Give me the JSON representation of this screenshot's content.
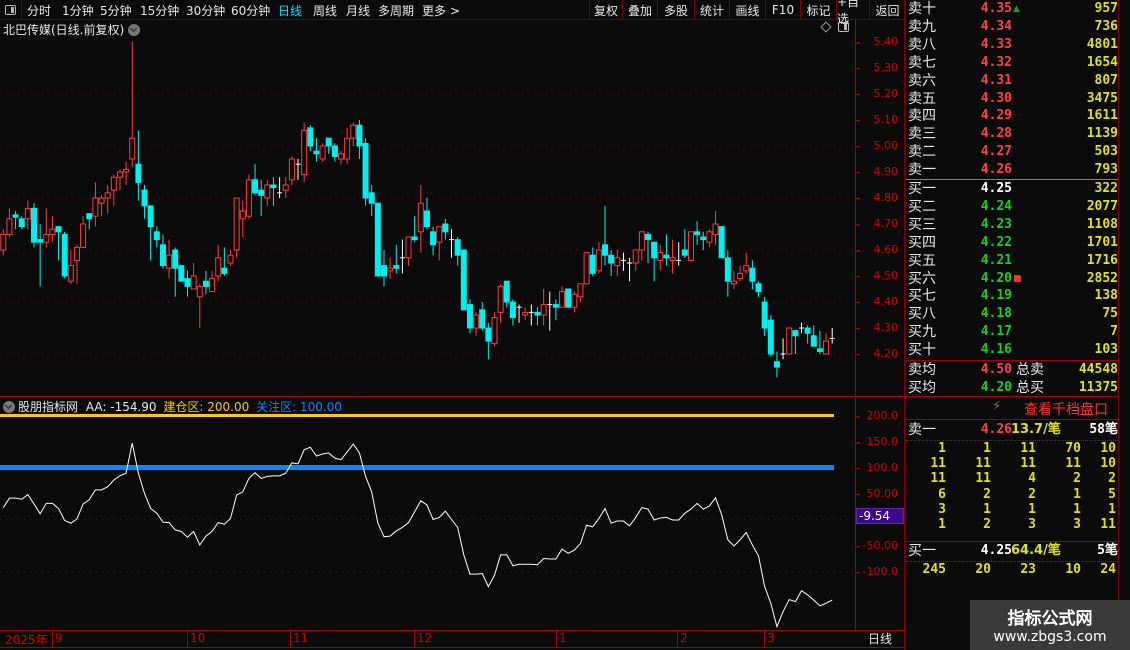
{
  "toolbar": {
    "periods": [
      "分时",
      "1分钟",
      "5分钟",
      "15分钟",
      "30分钟",
      "60分钟",
      "日线",
      "周线",
      "月线",
      "多周期",
      "更多 >"
    ],
    "active_period": "日线",
    "buttons": [
      "复权",
      "叠加",
      "多股",
      "统计",
      "画线",
      "F10",
      "标记",
      "+自选",
      "返回"
    ]
  },
  "chart_title": "北巴传媒(日线.前复权)",
  "indicator": {
    "name": "股朋指标网",
    "aa_label": "AA: -154.90",
    "build_label": "建仓区: 200.00",
    "watch_label": "关注区: 100.00",
    "current_value": "-9.54"
  },
  "colors": {
    "up": "#ff3b3b",
    "down": "#00f0f0",
    "build_line": "#ffc800",
    "watch_line": "#0a84ff",
    "axis": "#c00000"
  },
  "date_axis": {
    "labels": [
      "2025年",
      "9",
      "10",
      "11",
      "12",
      "1",
      "2",
      "3"
    ],
    "period": "日线"
  },
  "chart_data": [
    {
      "type": "candlestick",
      "title": "北巴传媒(日线.前复权)",
      "yticks": [
        "5.40",
        "5.30",
        "5.20",
        "5.10",
        "5.00",
        "4.90",
        "4.80",
        "4.70",
        "4.60",
        "4.50",
        "4.40",
        "4.30",
        "4.20"
      ],
      "ylim": [
        4.1,
        5.45
      ],
      "ohlc": [
        [
          4.6,
          4.68,
          4.58,
          4.66
        ],
        [
          4.66,
          4.76,
          4.65,
          4.72
        ],
        [
          4.735,
          4.75,
          4.68,
          4.726
        ],
        [
          4.72,
          4.73,
          4.68,
          4.69
        ],
        [
          4.72,
          4.79,
          4.68,
          4.76
        ],
        [
          4.76,
          4.78,
          4.61,
          4.63
        ],
        [
          4.64,
          4.7,
          4.46,
          4.63
        ],
        [
          4.63,
          4.76,
          4.61,
          4.66
        ],
        [
          4.66,
          4.73,
          4.63,
          4.68
        ],
        [
          4.69,
          4.69,
          4.56,
          4.67
        ],
        [
          4.66,
          4.67,
          4.49,
          4.5
        ],
        [
          4.48,
          4.6,
          4.47,
          4.54
        ],
        [
          4.56,
          4.62,
          4.47,
          4.61
        ],
        [
          4.61,
          4.73,
          4.61,
          4.7
        ],
        [
          4.74,
          4.74,
          4.68,
          4.72
        ],
        [
          4.73,
          4.86,
          4.69,
          4.8
        ],
        [
          4.78,
          4.81,
          4.73,
          4.8
        ],
        [
          4.8,
          4.85,
          4.74,
          4.82
        ],
        [
          4.83,
          4.89,
          4.77,
          4.88
        ],
        [
          4.88,
          4.91,
          4.83,
          4.9
        ],
        [
          4.9,
          4.94,
          4.85,
          4.91
        ],
        [
          4.95,
          5.4,
          4.92,
          5.03
        ],
        [
          4.93,
          5.06,
          4.79,
          4.86
        ],
        [
          4.83,
          4.85,
          4.72,
          4.77
        ],
        [
          4.77,
          4.77,
          4.56,
          4.69
        ],
        [
          4.67,
          4.69,
          4.61,
          4.64
        ],
        [
          4.62,
          4.66,
          4.53,
          4.54
        ],
        [
          4.53,
          4.64,
          4.49,
          4.58
        ],
        [
          4.6,
          4.61,
          4.42,
          4.53
        ],
        [
          4.54,
          4.54,
          4.48,
          4.48
        ],
        [
          4.49,
          4.52,
          4.42,
          4.46
        ],
        [
          4.45,
          4.55,
          4.45,
          4.5
        ],
        [
          4.42,
          4.47,
          4.3,
          4.46
        ],
        [
          4.48,
          4.52,
          4.43,
          4.46
        ],
        [
          4.44,
          4.52,
          4.44,
          4.49
        ],
        [
          4.5,
          4.62,
          4.48,
          4.57
        ],
        [
          4.53,
          4.61,
          4.5,
          4.51
        ],
        [
          4.55,
          4.6,
          4.54,
          4.58
        ],
        [
          4.6,
          4.8,
          4.57,
          4.8
        ],
        [
          4.72,
          4.79,
          4.65,
          4.75
        ],
        [
          4.73,
          4.89,
          4.72,
          4.87
        ],
        [
          4.87,
          4.93,
          4.81,
          4.82
        ],
        [
          4.83,
          4.87,
          4.73,
          4.81
        ],
        [
          4.8,
          4.87,
          4.77,
          4.85
        ],
        [
          4.85,
          4.88,
          4.77,
          4.84
        ],
        [
          4.82,
          4.88,
          4.8,
          4.82
        ],
        [
          4.83,
          4.88,
          4.8,
          4.85
        ],
        [
          4.87,
          4.96,
          4.85,
          4.95
        ],
        [
          4.93,
          4.95,
          4.87,
          4.93
        ],
        [
          4.89,
          5.09,
          4.86,
          5.06
        ],
        [
          5.07,
          5.08,
          4.98,
          5.0
        ],
        [
          4.98,
          5.03,
          4.94,
          4.97
        ],
        [
          4.95,
          5.01,
          4.94,
          5.0
        ],
        [
          5.03,
          5.03,
          4.97,
          5.0
        ],
        [
          5.0,
          5.01,
          4.94,
          4.96
        ],
        [
          4.95,
          4.98,
          4.93,
          4.97
        ],
        [
          4.95,
          5.07,
          4.93,
          5.03
        ],
        [
          5.03,
          5.09,
          5.0,
          5.08
        ],
        [
          5.08,
          5.1,
          4.95,
          5.0
        ],
        [
          5.01,
          5.03,
          4.77,
          4.8
        ],
        [
          4.82,
          4.85,
          4.73,
          4.78
        ],
        [
          4.78,
          4.78,
          4.5,
          4.5
        ],
        [
          4.54,
          4.6,
          4.46,
          4.5
        ],
        [
          4.52,
          4.57,
          4.49,
          4.53
        ],
        [
          4.54,
          4.62,
          4.51,
          4.53
        ],
        [
          4.57,
          4.64,
          4.51,
          4.57
        ],
        [
          4.57,
          4.65,
          4.54,
          4.65
        ],
        [
          4.65,
          4.73,
          4.63,
          4.64
        ],
        [
          4.67,
          4.85,
          4.59,
          4.78
        ],
        [
          4.75,
          4.8,
          4.68,
          4.69
        ],
        [
          4.67,
          4.69,
          4.58,
          4.62
        ],
        [
          4.63,
          4.69,
          4.56,
          4.69
        ],
        [
          4.7,
          4.72,
          4.64,
          4.67
        ],
        [
          4.64,
          4.68,
          4.57,
          4.64
        ],
        [
          4.64,
          4.65,
          4.54,
          4.58
        ],
        [
          4.6,
          4.6,
          4.37,
          4.37
        ],
        [
          4.39,
          4.41,
          4.28,
          4.3
        ],
        [
          4.3,
          4.36,
          4.27,
          4.35
        ],
        [
          4.37,
          4.4,
          4.29,
          4.3
        ],
        [
          4.3,
          4.32,
          4.18,
          4.25
        ],
        [
          4.24,
          4.36,
          4.23,
          4.34
        ],
        [
          4.36,
          4.47,
          4.32,
          4.46
        ],
        [
          4.48,
          4.48,
          4.38,
          4.4
        ],
        [
          4.4,
          4.41,
          4.31,
          4.34
        ],
        [
          4.38,
          4.39,
          4.32,
          4.38
        ],
        [
          4.35,
          4.38,
          4.33,
          4.36
        ],
        [
          4.36,
          4.39,
          4.31,
          4.36
        ],
        [
          4.36,
          4.38,
          4.31,
          4.35
        ],
        [
          4.35,
          4.45,
          4.31,
          4.39
        ],
        [
          4.39,
          4.44,
          4.29,
          4.39
        ],
        [
          4.39,
          4.41,
          4.33,
          4.38
        ],
        [
          4.38,
          4.46,
          4.38,
          4.44
        ],
        [
          4.45,
          4.45,
          4.38,
          4.38
        ],
        [
          4.38,
          4.44,
          4.36,
          4.43
        ],
        [
          4.42,
          4.47,
          4.4,
          4.47
        ],
        [
          4.47,
          4.59,
          4.47,
          4.59
        ],
        [
          4.58,
          4.61,
          4.5,
          4.51
        ],
        [
          4.52,
          4.63,
          4.51,
          4.6
        ],
        [
          4.62,
          4.77,
          4.54,
          4.58
        ],
        [
          4.58,
          4.6,
          4.5,
          4.55
        ],
        [
          4.54,
          4.6,
          4.5,
          4.57
        ],
        [
          4.56,
          4.59,
          4.52,
          4.56
        ],
        [
          4.55,
          4.57,
          4.48,
          4.55
        ],
        [
          4.55,
          4.6,
          4.52,
          4.6
        ],
        [
          4.6,
          4.67,
          4.56,
          4.67
        ],
        [
          4.66,
          4.67,
          4.55,
          4.64
        ],
        [
          4.63,
          4.63,
          4.48,
          4.57
        ],
        [
          4.56,
          4.62,
          4.52,
          4.59
        ],
        [
          4.58,
          4.66,
          4.54,
          4.57
        ],
        [
          4.56,
          4.64,
          4.51,
          4.57
        ],
        [
          4.56,
          4.63,
          4.54,
          4.56
        ],
        [
          4.6,
          4.68,
          4.57,
          4.58
        ],
        [
          4.56,
          4.67,
          4.56,
          4.67
        ],
        [
          4.67,
          4.71,
          4.62,
          4.66
        ],
        [
          4.65,
          4.67,
          4.6,
          4.64
        ],
        [
          4.63,
          4.68,
          4.61,
          4.67
        ],
        [
          4.66,
          4.75,
          4.62,
          4.7
        ],
        [
          4.69,
          4.69,
          4.57,
          4.57
        ],
        [
          4.57,
          4.6,
          4.42,
          4.48
        ],
        [
          4.47,
          4.52,
          4.45,
          4.48
        ],
        [
          4.49,
          4.54,
          4.48,
          4.51
        ],
        [
          4.52,
          4.59,
          4.51,
          4.54
        ],
        [
          4.53,
          4.56,
          4.45,
          4.48
        ],
        [
          4.47,
          4.48,
          4.42,
          4.44
        ],
        [
          4.4,
          4.42,
          4.27,
          4.3
        ],
        [
          4.33,
          4.35,
          4.19,
          4.2
        ],
        [
          4.17,
          4.21,
          4.11,
          4.15
        ],
        [
          4.2,
          4.26,
          4.18,
          4.2
        ],
        [
          4.2,
          4.3,
          4.2,
          4.3
        ],
        [
          4.29,
          4.29,
          4.2,
          4.27
        ],
        [
          4.3,
          4.32,
          4.28,
          4.3
        ],
        [
          4.3,
          4.31,
          4.24,
          4.28
        ],
        [
          4.27,
          4.31,
          4.23,
          4.23
        ],
        [
          4.22,
          4.29,
          4.2,
          4.21
        ],
        [
          4.2,
          4.28,
          4.2,
          4.25
        ],
        [
          4.26,
          4.3,
          4.24,
          4.26
        ]
      ]
    },
    {
      "type": "line",
      "title": "股朋指标网",
      "yticks": [
        "200.0",
        "150.0",
        "100.0",
        "50.00",
        "-50.00",
        "-100.0"
      ],
      "ylim": [
        -220,
        215
      ],
      "series": [
        {
          "name": "AA",
          "values": [
            23,
            41,
            41,
            39,
            48,
            30,
            11,
            31,
            31,
            21,
            -2,
            -7,
            1,
            30,
            38,
            57,
            57,
            63,
            76,
            84,
            89,
            147,
            89,
            50,
            21,
            12,
            -5,
            -6,
            -20,
            -23,
            -34,
            -23,
            -49,
            -32,
            -23,
            -6,
            -9,
            2,
            47,
            53,
            79,
            90,
            79,
            83,
            84,
            84,
            89,
            109,
            107,
            134,
            139,
            122,
            126,
            128,
            118,
            115,
            130,
            145,
            128,
            83,
            53,
            -7,
            -33,
            -32,
            -22,
            -15,
            -6,
            15,
            36,
            28,
            0,
            4,
            16,
            0,
            -15,
            -68,
            -105,
            -105,
            -104,
            -129,
            -107,
            -68,
            -68,
            -89,
            -86,
            -86,
            -86,
            -87,
            -75,
            -76,
            -76,
            -57,
            -65,
            -59,
            -46,
            -11,
            -14,
            2,
            21,
            -7,
            -3,
            -3,
            -12,
            4,
            23,
            20,
            -1,
            3,
            4,
            -1,
            -1,
            12,
            20,
            31,
            20,
            26,
            42,
            9,
            -39,
            -51,
            -39,
            -25,
            -49,
            -70,
            -129,
            -161,
            -206,
            -177,
            -154,
            -158,
            -137,
            -145,
            -155,
            -166,
            -161,
            -155
          ]
        },
        {
          "name": "建仓区",
          "value": 200
        },
        {
          "name": "关注区",
          "value": 100
        }
      ]
    }
  ],
  "order_book": {
    "asks": [
      {
        "label": "卖十",
        "price": "4.35",
        "qty": "957",
        "mark": "up"
      },
      {
        "label": "卖九",
        "price": "4.34",
        "qty": "736"
      },
      {
        "label": "卖八",
        "price": "4.33",
        "qty": "4801"
      },
      {
        "label": "卖七",
        "price": "4.32",
        "qty": "1654"
      },
      {
        "label": "卖六",
        "price": "4.31",
        "qty": "807"
      },
      {
        "label": "卖五",
        "price": "4.30",
        "qty": "3475"
      },
      {
        "label": "卖四",
        "price": "4.29",
        "qty": "1611"
      },
      {
        "label": "卖三",
        "price": "4.28",
        "qty": "1139"
      },
      {
        "label": "卖二",
        "price": "4.27",
        "qty": "503"
      },
      {
        "label": "卖一",
        "price": "4.26",
        "qty": "793"
      }
    ],
    "bids": [
      {
        "label": "买一",
        "price": "4.25",
        "qty": "322"
      },
      {
        "label": "买二",
        "price": "4.24",
        "qty": "2077"
      },
      {
        "label": "买三",
        "price": "4.23",
        "qty": "1108"
      },
      {
        "label": "买四",
        "price": "4.22",
        "qty": "1701"
      },
      {
        "label": "买五",
        "price": "4.21",
        "qty": "1716"
      },
      {
        "label": "买六",
        "price": "4.20",
        "qty": "2852",
        "mark": "dot"
      },
      {
        "label": "买七",
        "price": "4.19",
        "qty": "138"
      },
      {
        "label": "买八",
        "price": "4.18",
        "qty": "75"
      },
      {
        "label": "买九",
        "price": "4.17",
        "qty": "7"
      },
      {
        "label": "买十",
        "price": "4.16",
        "qty": "103"
      }
    ],
    "summary": [
      {
        "label": "卖均",
        "price": "4.50",
        "label2": "总卖",
        "qty": "44548"
      },
      {
        "label": "买均",
        "price": "4.20",
        "label2": "总买",
        "qty": "11375"
      }
    ],
    "depth_link": "查看千档盘口",
    "ask1_detail": {
      "label": "卖一",
      "price": "4.26",
      "avg": "13.7/笔",
      "count": "58笔",
      "queue": [
        [
          "1",
          "1",
          "11",
          "70",
          "10"
        ],
        [
          "11",
          "11",
          "11",
          "11",
          "10"
        ],
        [
          "11",
          "11",
          "4",
          "2",
          "2"
        ],
        [
          "6",
          "2",
          "2",
          "1",
          "5"
        ],
        [
          "3",
          "1",
          "1",
          "1",
          "1"
        ],
        [
          "1",
          "2",
          "3",
          "3",
          "11"
        ]
      ]
    },
    "bid1_detail": {
      "label": "买一",
      "price": "4.25",
      "avg": "64.4/笔",
      "count": "5笔",
      "queue": [
        [
          "245",
          "20",
          "23",
          "10",
          "24"
        ]
      ]
    }
  },
  "watermark": {
    "name": "指标公式网",
    "url": "www.zbgs3.com"
  }
}
